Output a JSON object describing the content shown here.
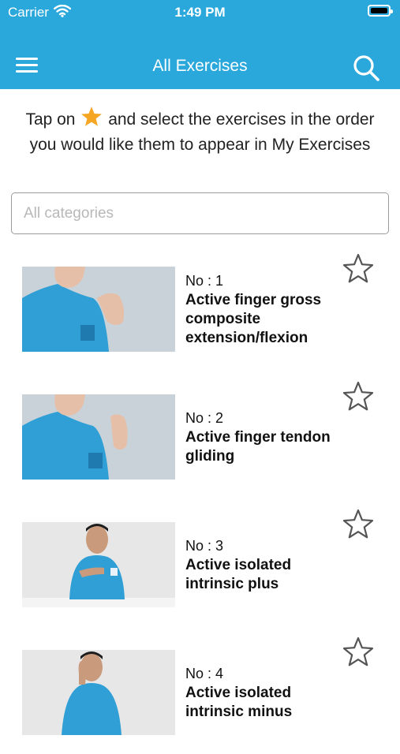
{
  "status": {
    "carrier": "Carrier",
    "time": "1:49 PM"
  },
  "nav": {
    "title": "All Exercises",
    "menu_icon": "hamburger-menu-icon",
    "search_icon": "search-icon"
  },
  "instruction": {
    "before": "Tap on",
    "after": "and select the exercises in the order you would like them to appear in My Exercises",
    "star_color": "#f5a623"
  },
  "category": {
    "placeholder": "All categories",
    "value": ""
  },
  "exercises": [
    {
      "no": "No : 1",
      "title": "Active finger gross composite extension/flexion"
    },
    {
      "no": "No : 2",
      "title": "Active finger tendon gliding"
    },
    {
      "no": "No : 3",
      "title": "Active isolated intrinsic plus"
    },
    {
      "no": "No : 4",
      "title": "Active isolated intrinsic minus"
    }
  ],
  "colors": {
    "header": "#2aa8dc",
    "shirt": "#2f9fd6"
  }
}
